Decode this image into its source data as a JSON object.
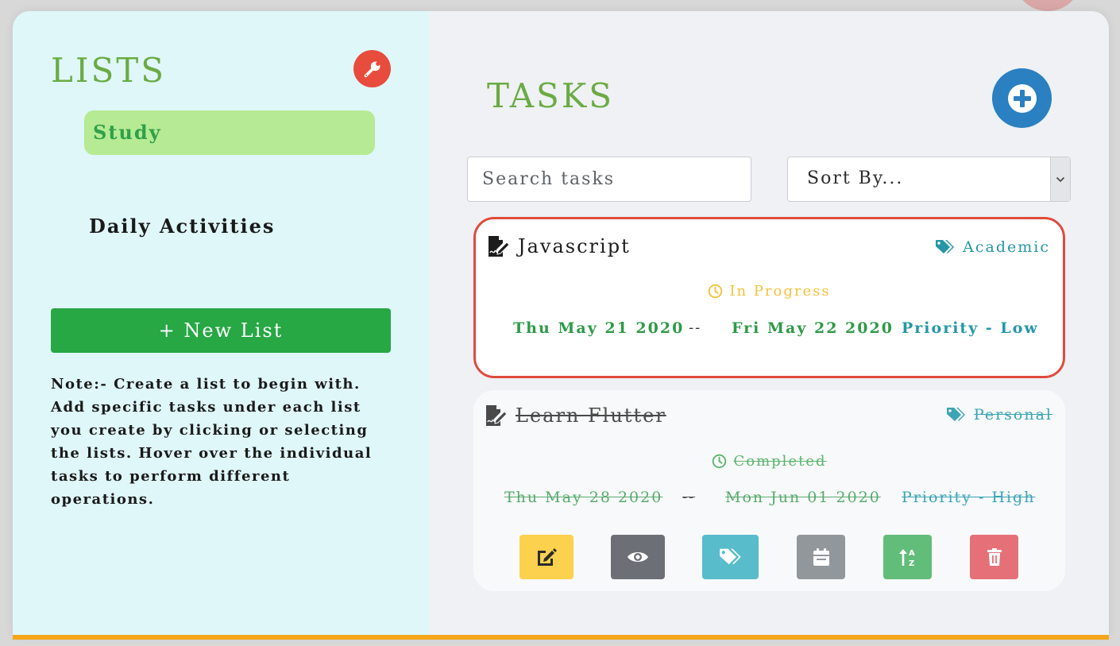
{
  "sidebar": {
    "title": "LISTS",
    "settings_icon": "wrench-icon",
    "lists": [
      {
        "label": "Study",
        "active": true
      },
      {
        "label": "Daily Activities",
        "active": false
      }
    ],
    "new_list_label": "+ New List",
    "note": "Note:- Create a list to begin with. Add specific tasks under each list you create by clicking or selecting the lists. Hover over the individual tasks to perform different operations."
  },
  "main": {
    "title": "TASKS",
    "add_icon": "plus-circle-icon",
    "search_placeholder": "Search tasks",
    "sort_label": "Sort By..."
  },
  "tasks": [
    {
      "title": "Javascript",
      "tag": "Academic",
      "status": "In Progress",
      "start_date": "Thu May 21 2020",
      "separator": "--",
      "end_date": "Fri May 22 2020",
      "priority": "Priority - Low",
      "completed": false,
      "selected": true
    },
    {
      "title": "Learn Flutter",
      "tag": "Personal",
      "status": "Completed",
      "start_date": "Thu May 28 2020",
      "separator": "--",
      "end_date": "Mon Jun 01 2020",
      "priority": "Priority - High",
      "completed": true,
      "selected": false
    }
  ],
  "task_actions": [
    {
      "name": "edit",
      "icon": "edit-icon",
      "color": "#fcd14d"
    },
    {
      "name": "view",
      "icon": "eye-icon",
      "color": "#6c6f76"
    },
    {
      "name": "tag",
      "icon": "tags-icon",
      "color": "#58bccb"
    },
    {
      "name": "date",
      "icon": "calendar-icon",
      "color": "#92979c"
    },
    {
      "name": "sort",
      "icon": "sort-alpha-icon",
      "color": "#62bc7a"
    },
    {
      "name": "delete",
      "icon": "trash-icon",
      "color": "#e57078"
    }
  ],
  "colors": {
    "heading": "#6aab43",
    "accent_red": "#e74c3c",
    "add_blue": "#2a80c0",
    "new_list_green": "#28a745",
    "active_list_bg": "#b7ea94",
    "sidebar_bg": "#dff7f9",
    "bottom_bar": "#f5a61b"
  }
}
